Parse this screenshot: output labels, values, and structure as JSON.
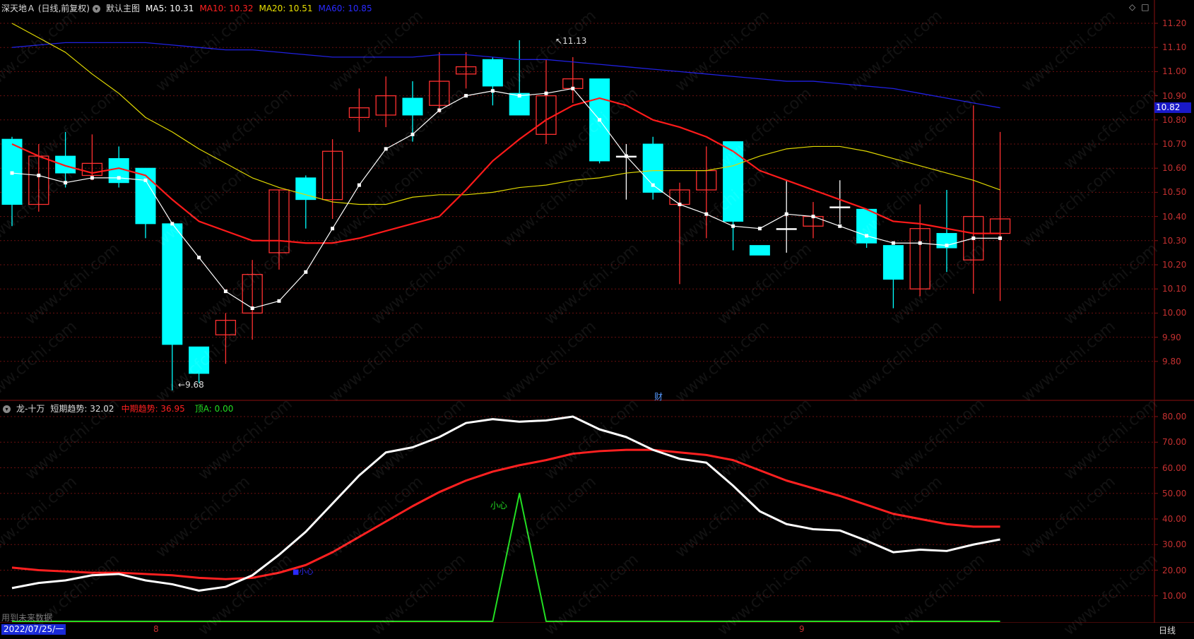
{
  "main_header": {
    "stock": "深天地Ａ (日线,前复权)",
    "template": "默认主图",
    "ma5": "MA5: 10.31",
    "ma10": "MA10: 10.32",
    "ma20": "MA20: 10.51",
    "ma60": "MA60: 10.85",
    "colors": {
      "ma5": "#ffffff",
      "ma10": "#ff2020",
      "ma20": "#e8e000",
      "ma60": "#2020ff"
    }
  },
  "sub_header": {
    "name": "龙-十万",
    "short": "短期趋势: 32.02",
    "mid": "中期趋势: 36.95",
    "top": "顶A: 0.00"
  },
  "annotations": {
    "high": "11.13",
    "low": "9.68",
    "cai": "财",
    "careful": "小心",
    "blue_mark": "■小心",
    "future": "用到未来数据"
  },
  "price_tag": "10.82",
  "date_start": "2022/07/25/一",
  "x_labels": [
    "8",
    "9"
  ],
  "day_button": "日线",
  "y_axis_main": [
    "11.20",
    "11.10",
    "11.00",
    "10.90",
    "10.80",
    "10.70",
    "10.60",
    "10.50",
    "10.40",
    "10.30",
    "10.20",
    "10.10",
    "10.00",
    "9.90",
    "9.80"
  ],
  "y_axis_sub": [
    "80.00",
    "70.00",
    "60.00",
    "50.00",
    "40.00",
    "30.00",
    "20.00",
    "10.00"
  ],
  "watermark": "www.cfchi.com",
  "chart_data": {
    "type": "candlestick",
    "candles": [
      [
        10.72,
        10.45,
        10.73,
        10.36
      ],
      [
        10.45,
        10.65,
        10.7,
        10.42
      ],
      [
        10.65,
        10.58,
        10.75,
        10.52
      ],
      [
        10.57,
        10.62,
        10.74,
        10.55
      ],
      [
        10.64,
        10.54,
        10.69,
        10.52
      ],
      [
        10.6,
        10.37,
        10.6,
        10.31
      ],
      [
        10.37,
        9.87,
        10.37,
        9.68
      ],
      [
        9.86,
        9.75,
        9.86,
        9.71
      ],
      [
        9.91,
        9.97,
        10.0,
        9.79
      ],
      [
        10.0,
        10.16,
        10.22,
        9.89
      ],
      [
        10.25,
        10.51,
        10.51,
        10.18
      ],
      [
        10.56,
        10.47,
        10.57,
        10.35
      ],
      [
        10.47,
        10.67,
        10.72,
        10.39
      ],
      [
        10.81,
        10.85,
        10.93,
        10.75
      ],
      [
        10.82,
        10.9,
        10.98,
        10.77
      ],
      [
        10.89,
        10.82,
        10.96,
        10.71
      ],
      [
        10.86,
        10.96,
        11.08,
        10.83
      ],
      [
        10.99,
        11.02,
        11.08,
        10.93
      ],
      [
        11.05,
        10.94,
        11.06,
        10.86
      ],
      [
        10.91,
        10.82,
        11.13,
        10.83
      ],
      [
        10.74,
        10.9,
        11.05,
        10.7
      ],
      [
        10.93,
        10.97,
        11.06,
        10.87
      ],
      [
        10.97,
        10.63,
        10.97,
        10.62
      ],
      [
        10.65,
        10.65,
        10.7,
        10.47
      ],
      [
        10.7,
        10.5,
        10.73,
        10.47
      ],
      [
        10.45,
        10.51,
        10.54,
        10.12
      ],
      [
        10.51,
        10.59,
        10.69,
        10.31
      ],
      [
        10.71,
        10.38,
        10.71,
        10.26
      ],
      [
        10.28,
        10.24,
        10.28,
        10.24
      ],
      [
        10.35,
        10.35,
        10.55,
        10.25
      ],
      [
        10.36,
        10.4,
        10.46,
        10.31
      ],
      [
        10.44,
        10.44,
        10.55,
        10.37
      ],
      [
        10.43,
        10.29,
        10.43,
        10.27
      ],
      [
        10.28,
        10.14,
        10.28,
        10.02
      ],
      [
        10.1,
        10.35,
        10.45,
        10.07
      ],
      [
        10.33,
        10.27,
        10.51,
        10.17
      ],
      [
        10.22,
        10.4,
        10.86,
        10.08
      ],
      [
        10.33,
        10.39,
        10.75,
        10.05
      ]
    ],
    "ma5": [
      10.58,
      10.57,
      10.54,
      10.56,
      10.56,
      10.55,
      10.37,
      10.23,
      10.09,
      10.02,
      10.05,
      10.17,
      10.35,
      10.53,
      10.68,
      10.74,
      10.84,
      10.9,
      10.92,
      10.9,
      10.91,
      10.93,
      10.8,
      10.65,
      10.53,
      10.45,
      10.41,
      10.36,
      10.35,
      10.41,
      10.4,
      10.36,
      10.32,
      10.29,
      10.29,
      10.28,
      10.31,
      10.31
    ],
    "ma10": [
      10.7,
      10.65,
      10.61,
      10.58,
      10.6,
      10.57,
      10.47,
      10.38,
      10.34,
      10.3,
      10.3,
      10.29,
      10.29,
      10.31,
      10.34,
      10.37,
      10.4,
      10.51,
      10.63,
      10.72,
      10.8,
      10.86,
      10.89,
      10.86,
      10.8,
      10.77,
      10.73,
      10.67,
      10.59,
      10.55,
      10.51,
      10.47,
      10.43,
      10.38,
      10.37,
      10.35,
      10.33,
      10.33
    ],
    "ma20": [
      11.2,
      11.14,
      11.08,
      10.99,
      10.91,
      10.81,
      10.75,
      10.68,
      10.62,
      10.56,
      10.52,
      10.49,
      10.46,
      10.45,
      10.45,
      10.48,
      10.49,
      10.49,
      10.5,
      10.52,
      10.53,
      10.55,
      10.56,
      10.58,
      10.59,
      10.59,
      10.59,
      10.61,
      10.65,
      10.68,
      10.69,
      10.69,
      10.67,
      10.64,
      10.61,
      10.58,
      10.55,
      10.51
    ],
    "ma60": [
      11.1,
      11.11,
      11.12,
      11.12,
      11.12,
      11.12,
      11.11,
      11.1,
      11.09,
      11.09,
      11.08,
      11.07,
      11.06,
      11.06,
      11.06,
      11.06,
      11.07,
      11.07,
      11.06,
      11.05,
      11.05,
      11.04,
      11.03,
      11.02,
      11.01,
      11.0,
      10.99,
      10.98,
      10.97,
      10.96,
      10.96,
      10.95,
      10.94,
      10.93,
      10.91,
      10.89,
      10.87,
      10.85
    ],
    "short_trend": [
      13,
      15,
      16,
      18,
      18.5,
      16,
      14.5,
      12,
      13.5,
      18,
      26,
      35,
      46,
      57,
      66,
      68,
      72,
      77.5,
      79,
      78,
      78.5,
      80,
      75,
      72,
      67,
      63.5,
      62,
      53,
      43,
      38,
      36,
      35.5,
      31.5,
      27,
      28,
      27.5,
      30,
      32
    ],
    "mid_trend": [
      21,
      20,
      19.5,
      19,
      19,
      18.5,
      18,
      17,
      16.5,
      17,
      19,
      22,
      27,
      33,
      39,
      45,
      50.5,
      55,
      58.5,
      61,
      63,
      65.5,
      66.5,
      67,
      67,
      66,
      65,
      63,
      59,
      55,
      52,
      49,
      45.5,
      42,
      40,
      38,
      37,
      37
    ],
    "top_a": [
      0,
      0,
      0,
      0,
      0,
      0,
      0,
      0,
      0,
      0,
      0,
      0,
      0,
      0,
      0,
      0,
      0,
      0,
      0,
      50,
      0,
      0,
      0,
      0,
      0,
      0,
      0,
      0,
      0,
      0,
      0,
      0,
      0,
      0,
      0,
      0,
      0,
      0
    ]
  }
}
